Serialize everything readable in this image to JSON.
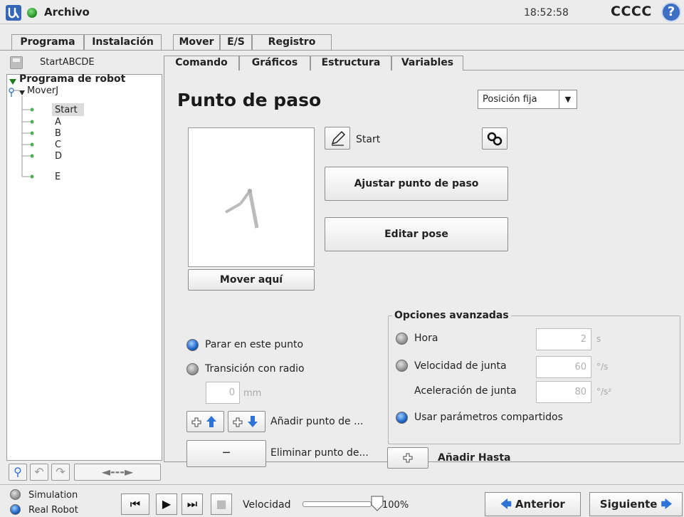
{
  "titlebar": {
    "title": "Archivo",
    "clock": "18:52:58",
    "robot_name": "CCCC",
    "help": "?"
  },
  "main_tabs": [
    {
      "label": "Programa",
      "active": true
    },
    {
      "label": "Instalación",
      "active": false
    },
    {
      "label": "Mover",
      "active": false
    },
    {
      "label": "E/S",
      "active": false
    },
    {
      "label": "Registro",
      "active": false
    }
  ],
  "program": {
    "name": "StartABCDE"
  },
  "tree": {
    "root": "Programa de robot",
    "move": "MoverJ",
    "nodes": [
      "Start",
      "A",
      "B",
      "C",
      "D",
      "E"
    ],
    "selected": "Start"
  },
  "tree_tools": {
    "resize": "◄---►"
  },
  "sub_tabs": [
    {
      "label": "Comando",
      "active": true
    },
    {
      "label": "Gráficos",
      "active": false
    },
    {
      "label": "Estructura",
      "active": false
    },
    {
      "label": "Variables",
      "active": false
    }
  ],
  "waypoint": {
    "title": "Punto de paso",
    "position_select": "Posición fija",
    "name": "Start",
    "move_here": "Mover aquí",
    "set_waypoint": "Ajustar punto de paso",
    "edit_pose": "Editar pose",
    "stop_label": "Parar en este punto",
    "blend_label": "Transición con radio",
    "blend_value": "0",
    "blend_unit": "mm",
    "add_waypoint": "Añadir punto de ...",
    "remove_waypoint": "Eliminar punto de...",
    "add_until": "Añadir Hasta"
  },
  "advanced": {
    "title": "Opciones avanzadas",
    "time_label": "Hora",
    "time_value": "2",
    "time_unit": "s",
    "joint_speed_label": "Velocidad de junta",
    "joint_speed_value": "60",
    "joint_speed_unit": "°/s",
    "joint_accel_label": "Aceleración de junta",
    "joint_accel_value": "80",
    "joint_accel_unit": "°/s²",
    "shared_label": "Usar parámetros compartidos"
  },
  "bottom": {
    "simulation": "Simulation",
    "real_robot": "Real Robot",
    "speed_label": "Velocidad",
    "speed_value": "100%",
    "speed_fraction": 1.0,
    "prev": "Anterior",
    "next": "Siguiente"
  },
  "colors": {
    "accent": "#2e74d6",
    "active_radio": "#1e64c8",
    "status_ok": "#1e8a1e"
  }
}
